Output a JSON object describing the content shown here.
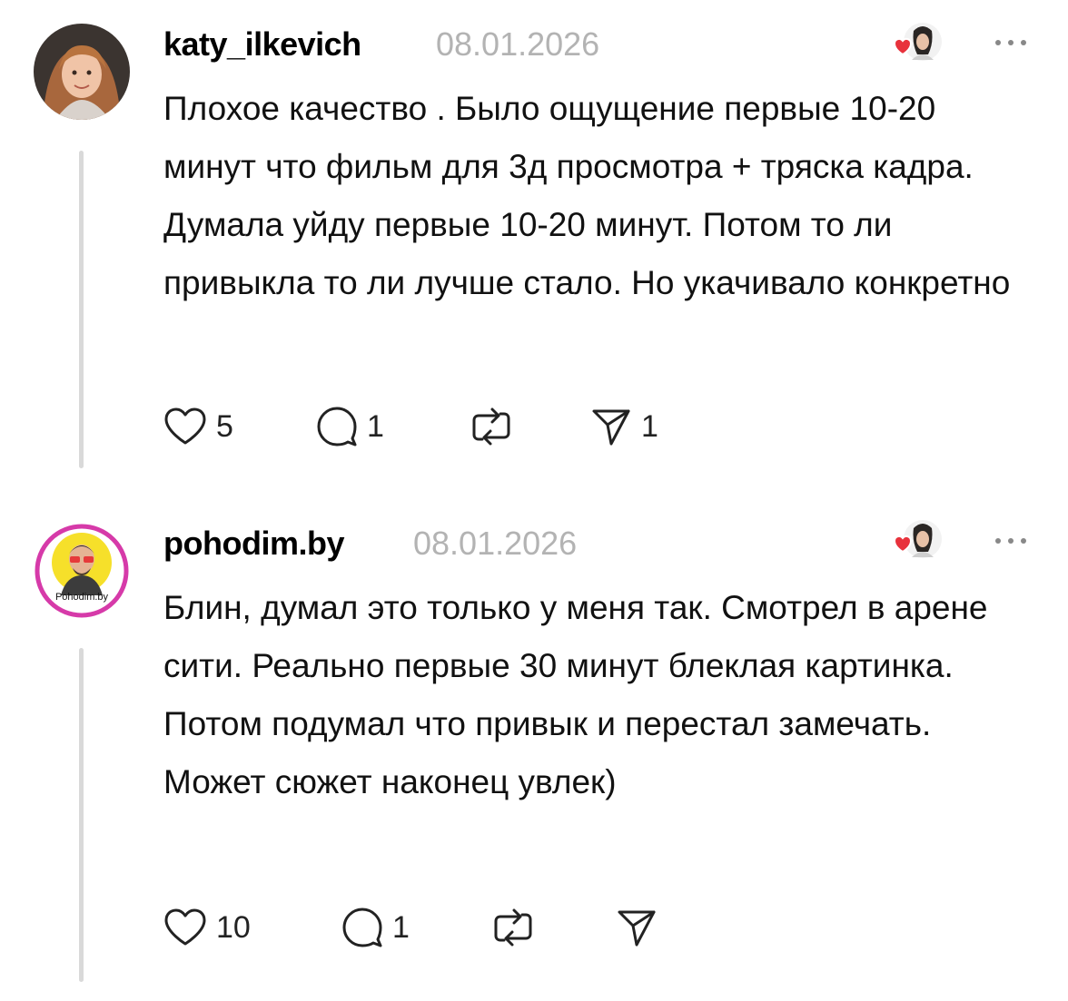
{
  "posts": [
    {
      "username": "katy_ilkevich",
      "date": "08.01.2026",
      "text": "Плохое качество . Было ощущение первые 10-20 минут что фильм для 3д просмотра + тряска кадра. Думала уйду первые 10-20 минут. Потом то ли привыкла то ли лучше стало. Но укачивало конкретно",
      "likes": "5",
      "replies": "1",
      "reposts": "",
      "shares": "1"
    },
    {
      "username": "pohodim.by",
      "date": "08.01.2026",
      "avatar_text": "Pohodim.by",
      "text": "Блин, думал это только у меня так. Смотрел в арене сити. Реально первые 30 минут блеклая картинка. Потом подумал что привык и перестал замечать. Может сюжет наконец увлек)",
      "likes": "10",
      "replies": "1",
      "reposts": "",
      "shares": ""
    }
  ],
  "colors": {
    "like_heart": "#e8323c",
    "muted": "#b3b3b3",
    "thread": "#d9d9d9",
    "avatar_ring": "#d63aa9",
    "avatar_bg": "#f6e02a"
  }
}
